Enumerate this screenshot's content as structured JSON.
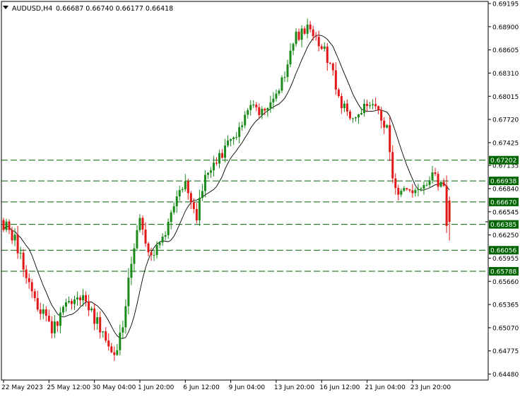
{
  "header": {
    "symbol": "AUDUSD,H4",
    "ohlc": "0.66687 0.66740 0.66177 0.66418",
    "collapse_icon": "triangle-down-icon"
  },
  "colors": {
    "background": "#ffffff",
    "frame": "#000000",
    "bull_candle": "#1a8a1a",
    "bear_candle": "#e01818",
    "moving_average": "#000000",
    "level_line": "#006400",
    "level_label_bg": "#006400",
    "level_label_text": "#ffffff",
    "axis_text": "#000000"
  },
  "chart_data": {
    "type": "candlestick",
    "symbol": "AUDUSD",
    "timeframe": "H4",
    "ylim": [
      0.6444,
      0.69195
    ],
    "y_ticks": [
      "0.69195",
      "0.68900",
      "0.68605",
      "0.68310",
      "0.68015",
      "0.67720",
      "0.67425",
      "0.67135",
      "0.66840",
      "0.66545",
      "0.66250",
      "0.65955",
      "0.65660",
      "0.65365",
      "0.65070",
      "0.64775",
      "0.64480"
    ],
    "x_labels": [
      "22 May 2023",
      "25 May 12:00",
      "30 May 04:00",
      "1 Jun 20:00",
      "6 Jun 12:00",
      "9 Jun 04:00",
      "13 Jun 20:00",
      "16 Jun 12:00",
      "21 Jun 04:00",
      "23 Jun 20:00"
    ],
    "x_label_index": [
      0,
      16,
      32,
      48,
      64,
      80,
      96,
      112,
      128,
      144
    ],
    "levels": [
      {
        "value": "0.67202"
      },
      {
        "value": "0.66938"
      },
      {
        "value": "0.66670"
      },
      {
        "value": "0.66385"
      },
      {
        "value": "0.66056"
      },
      {
        "value": "0.65788"
      }
    ],
    "close_marker": "0.66418",
    "path_points": [
      [
        0,
        0.6644
      ],
      [
        5,
        0.662
      ],
      [
        10,
        0.656
      ],
      [
        14,
        0.653
      ],
      [
        18,
        0.65
      ],
      [
        22,
        0.653
      ],
      [
        26,
        0.654
      ],
      [
        30,
        0.6545
      ],
      [
        33,
        0.652
      ],
      [
        37,
        0.649
      ],
      [
        40,
        0.647
      ],
      [
        43,
        0.651
      ],
      [
        46,
        0.659
      ],
      [
        49,
        0.664
      ],
      [
        53,
        0.66
      ],
      [
        57,
        0.662
      ],
      [
        61,
        0.666
      ],
      [
        65,
        0.669
      ],
      [
        69,
        0.665
      ],
      [
        72,
        0.67
      ],
      [
        76,
        0.6715
      ],
      [
        80,
        0.674
      ],
      [
        84,
        0.676
      ],
      [
        88,
        0.679
      ],
      [
        92,
        0.678
      ],
      [
        95,
        0.679
      ],
      [
        98,
        0.681
      ],
      [
        101,
        0.6845
      ],
      [
        104,
        0.688
      ],
      [
        108,
        0.6885
      ],
      [
        111,
        0.687
      ],
      [
        114,
        0.686
      ],
      [
        116,
        0.684
      ],
      [
        119,
        0.68
      ],
      [
        122,
        0.678
      ],
      [
        125,
        0.677
      ],
      [
        128,
        0.679
      ],
      [
        131,
        0.6795
      ],
      [
        134,
        0.677
      ],
      [
        136,
        0.676
      ],
      [
        138,
        0.67
      ],
      [
        140,
        0.6682
      ],
      [
        143,
        0.6683
      ],
      [
        146,
        0.6685
      ],
      [
        149,
        0.669
      ],
      [
        152,
        0.6705
      ],
      [
        154,
        0.669
      ],
      [
        156,
        0.668
      ],
      [
        157,
        0.6642
      ]
    ],
    "seed": 20230622
  }
}
